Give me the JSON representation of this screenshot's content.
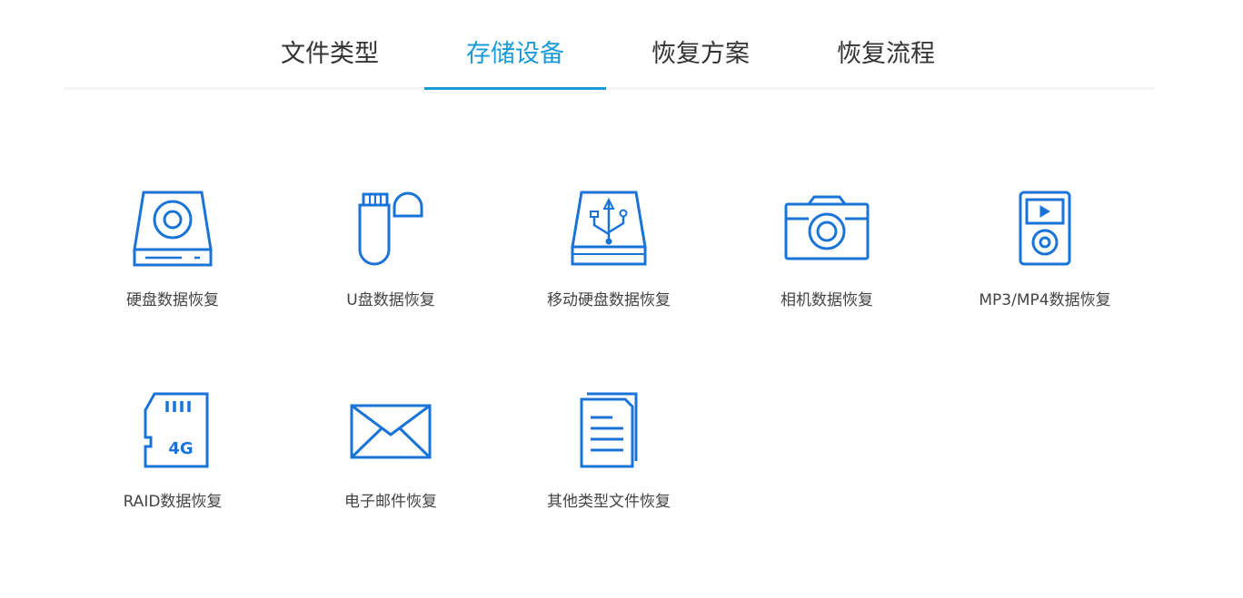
{
  "tabs": [
    {
      "label": "文件类型",
      "active": false
    },
    {
      "label": "存储设备",
      "active": true
    },
    {
      "label": "恢复方案",
      "active": false
    },
    {
      "label": "恢复流程",
      "active": false
    }
  ],
  "accent_color": "#1a9bd7",
  "icon_color": "#1a74d8",
  "devices": [
    {
      "label": "硬盘数据恢复",
      "icon": "hard-disk-icon"
    },
    {
      "label": "U盘数据恢复",
      "icon": "usb-drive-icon"
    },
    {
      "label": "移动硬盘数据恢复",
      "icon": "external-drive-icon"
    },
    {
      "label": "相机数据恢复",
      "icon": "camera-icon"
    },
    {
      "label": "MP3/MP4数据恢复",
      "icon": "media-player-icon"
    },
    {
      "label": "RAID数据恢复",
      "icon": "sd-card-icon",
      "icon_text": "4G"
    },
    {
      "label": "电子邮件恢复",
      "icon": "envelope-icon"
    },
    {
      "label": "其他类型文件恢复",
      "icon": "document-icon"
    }
  ]
}
